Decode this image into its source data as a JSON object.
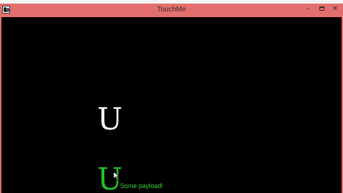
{
  "window": {
    "title": "TouchMe",
    "controls": {
      "minimize": "–",
      "close": "✕"
    }
  },
  "canvas": {
    "background": "#000000",
    "glyph_top": "U",
    "glyph_top_color": "#ffffff",
    "glyph_bottom": "U",
    "glyph_bottom_color": "#22c322",
    "payload_text": "Some payload!",
    "payload_color": "#3ad23a"
  },
  "theme": {
    "titlebar_color": "#e36f6f"
  },
  "icons": {
    "app": "app-icon",
    "cursor": "mouse-pointer-icon"
  }
}
